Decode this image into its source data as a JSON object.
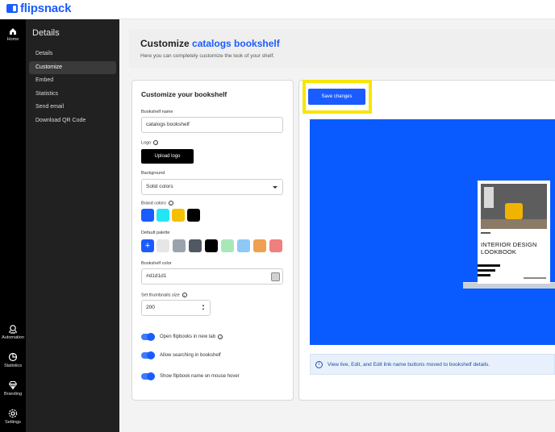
{
  "app": {
    "brand": "flipsnack"
  },
  "rail": [
    {
      "label": "Home",
      "icon": "home-icon"
    },
    {
      "label": "Automation",
      "icon": "automation-icon"
    },
    {
      "label": "Statistics",
      "icon": "statistics-icon"
    },
    {
      "label": "Branding",
      "icon": "branding-icon"
    },
    {
      "label": "Settings",
      "icon": "settings-icon"
    }
  ],
  "subnav": {
    "title": "Details",
    "items": [
      {
        "label": "Details",
        "active": false
      },
      {
        "label": "Customize",
        "active": true
      },
      {
        "label": "Embed",
        "active": false
      },
      {
        "label": "Statistics",
        "active": false
      },
      {
        "label": "Send email",
        "active": false
      },
      {
        "label": "Download QR Code",
        "active": false
      }
    ]
  },
  "header": {
    "title_prefix": "Customize",
    "title_highlight": "catalogs bookshelf",
    "subtitle": "Here you can completely customize the look of your shelf."
  },
  "form": {
    "title": "Customize your bookshelf",
    "name_label": "Bookshelf name",
    "name_value": "catalogs bookshelf",
    "logo_label": "Logo",
    "upload_label": "Upload logo",
    "background_label": "Background",
    "background_value": "Solid colors",
    "brand_colors_label": "Brand colors",
    "brand_colors": [
      "#1a5cff",
      "#22e6f5",
      "#f5c000",
      "#000000"
    ],
    "palette_label": "Default palette",
    "palette_add": "+",
    "palette": [
      "#e6e6e6",
      "#9aa3ad",
      "#4f5863",
      "#000000",
      "#a8e8b8",
      "#8ec8f5",
      "#f0a050",
      "#f08080"
    ],
    "shelf_color_label": "Bookshelf color",
    "shelf_color_value": "#d1d1d1",
    "thumb_label": "Set thumbnails size",
    "thumb_value": "200",
    "toggles": [
      {
        "label": "Open flipbooks in new tab",
        "on": true,
        "info": true
      },
      {
        "label": "Allow searching in bookshelf",
        "on": true,
        "info": false
      },
      {
        "label": "Show flipbook name on mouse hover",
        "on": true,
        "info": false
      }
    ]
  },
  "preview": {
    "save_label": "Save changes",
    "book_title": "INTERIOR DESIGN LOOKBOOK",
    "notice": "View live, Edit, and Edit link name buttons moved to bookshelf details."
  }
}
